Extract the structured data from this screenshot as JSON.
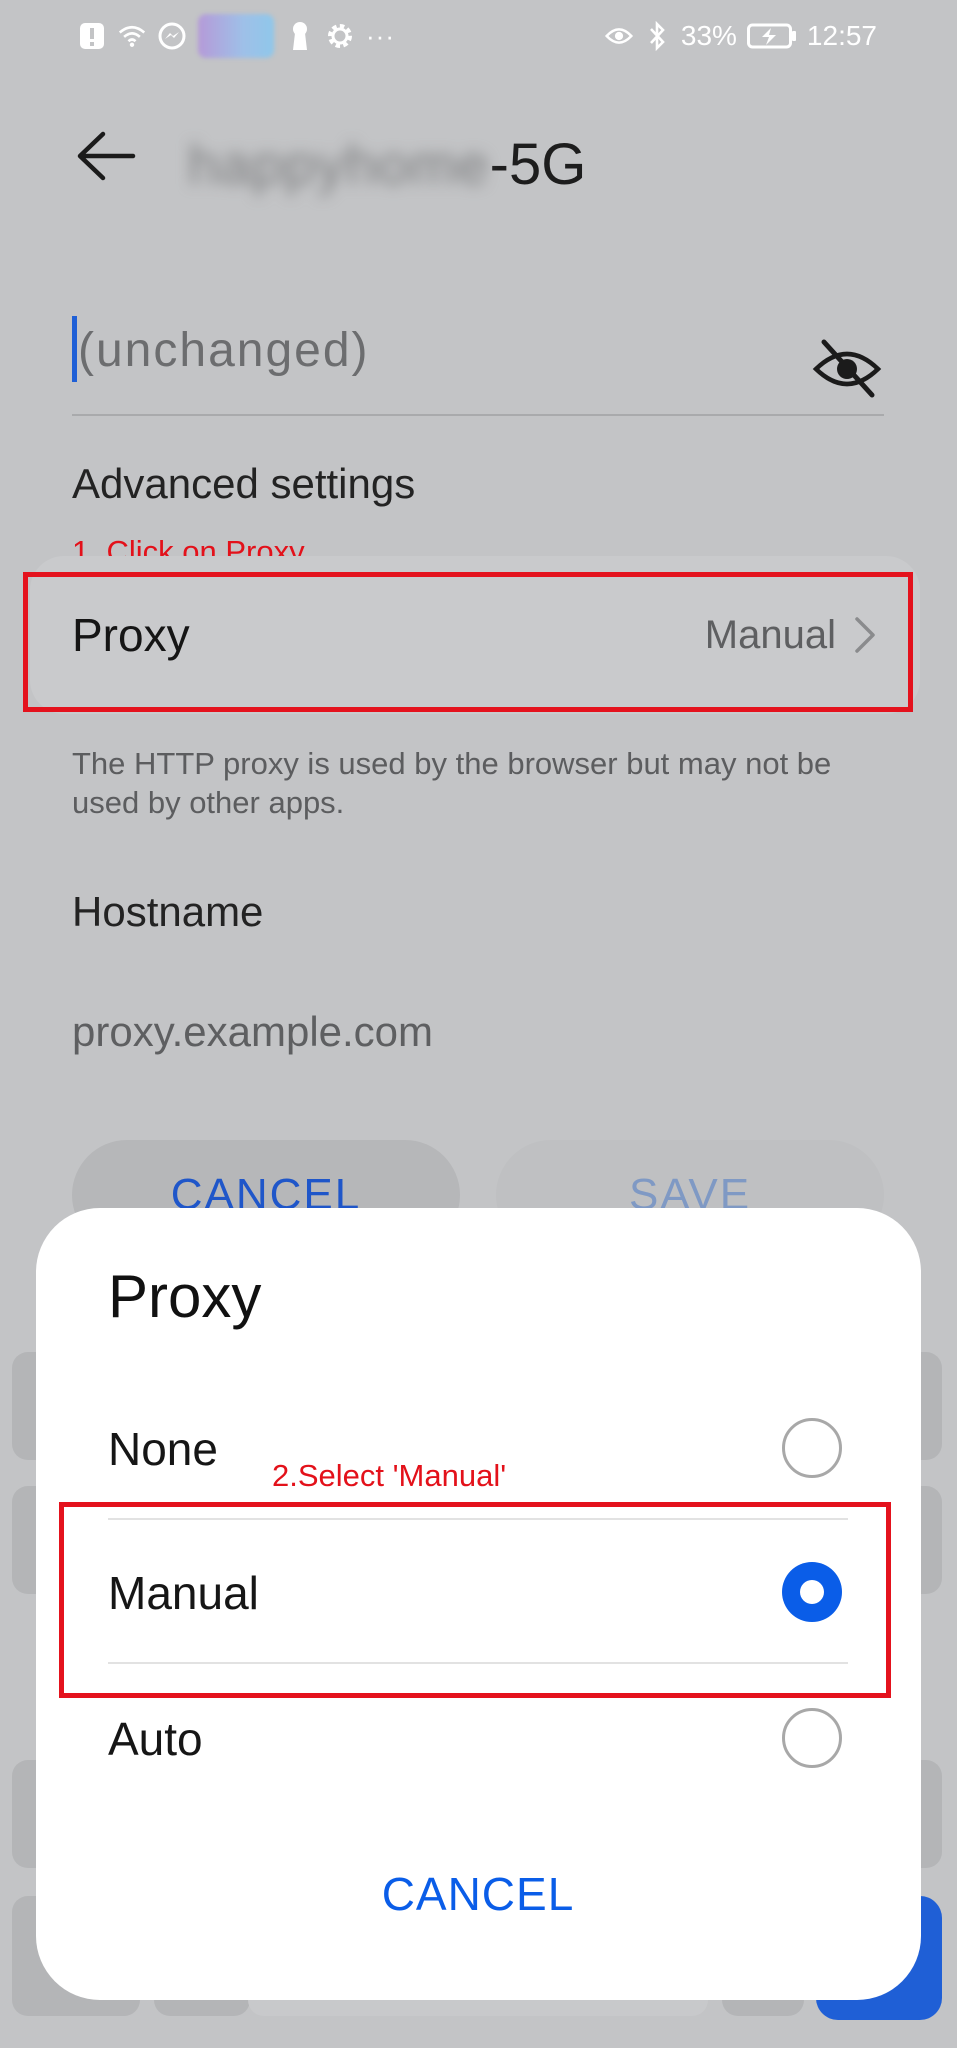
{
  "status_bar": {
    "battery": "33%",
    "time": "12:57",
    "more": "···"
  },
  "header": {
    "ssid_blurred": "happyhome",
    "ssid_suffix": "-5G"
  },
  "password": {
    "placeholder": "(unchanged)"
  },
  "advanced": {
    "title": "Advanced settings",
    "proxy_label": "Proxy",
    "proxy_value": "Manual",
    "help": "The HTTP proxy is used by the browser but may not be used by other apps.",
    "hostname_label": "Hostname",
    "hostname_value": "proxy.example.com",
    "cancel_label": "CANCEL",
    "save_label": "SAVE"
  },
  "annotations": {
    "step1": "1. Click on Proxy",
    "step2": "2.Select 'Manual'"
  },
  "dialog": {
    "title": "Proxy",
    "options": [
      {
        "label": "None",
        "selected": false
      },
      {
        "label": "Manual",
        "selected": true
      },
      {
        "label": "Auto",
        "selected": false
      }
    ],
    "cancel_label": "CANCEL"
  },
  "keyboard": {
    "partial_key": "?"
  },
  "colors": {
    "accent": "#0a5de8",
    "annotation": "#e4121d",
    "dim_background": "#c3c4c6"
  }
}
